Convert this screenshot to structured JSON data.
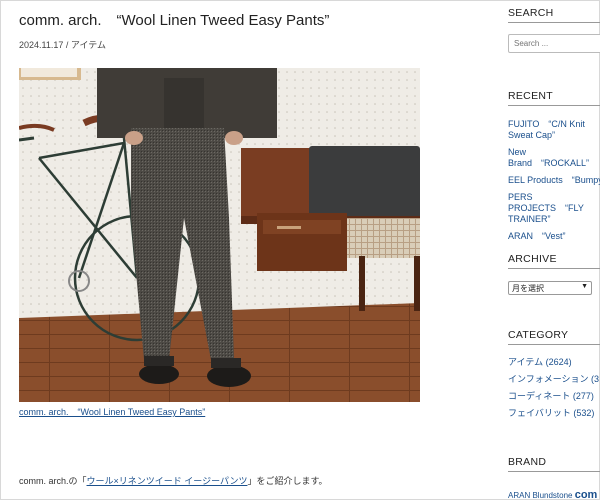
{
  "post": {
    "title": "comm. arch.　“Wool Linen Tweed Easy Pants”",
    "date": "2024.11.17",
    "separator": " / ",
    "category": "アイテム",
    "caption": "comm. arch.　“Wool Linen Tweed Easy Pants”",
    "body_prefix": "comm. arch.の「",
    "body_link": "ウール×リネンツイード イージーパンツ",
    "body_suffix": "」をご紹介します。"
  },
  "sidebar": {
    "search": {
      "title": "SEARCH",
      "placeholder": "Search ..."
    },
    "recent": {
      "title": "RECENT",
      "items": [
        "FUJITO　“C/N Knit Sweat Cap”",
        "New Brand　“ROCKALL”",
        "EEL Products　“Bumpy”",
        "PERS PROJECTS　“FLY TRAINER”",
        "ARAN　“Vest”"
      ]
    },
    "archive": {
      "title": "ARCHIVE",
      "select_value": "月を選択"
    },
    "category": {
      "title": "CATEGORY",
      "items": [
        "アイテム (2624)",
        "インフォメーション (3",
        "コーディネート (277)",
        "フェイバリット (532)"
      ]
    },
    "brand": {
      "title": "BRAND",
      "text_small": "ARAN Blundstone ",
      "text_large": "com"
    }
  },
  "colors": {
    "link": "#1a4f8c",
    "text": "#222222",
    "rule": "#999999"
  }
}
